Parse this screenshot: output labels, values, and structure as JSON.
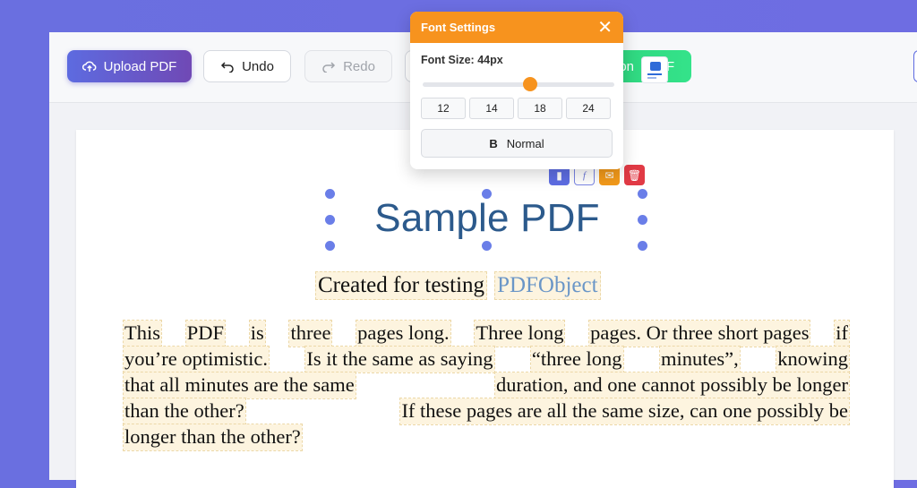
{
  "toolbar": {
    "upload_label": "Upload PDF",
    "undo_label": "Undo",
    "redo_label": "Redo",
    "export_label": "pon",
    "export_trailing": "F"
  },
  "document": {
    "title": "Sample PDF",
    "subtitle_words": [
      "Created for testing",
      "PDFObject"
    ],
    "paragraph_lines": [
      [
        "This",
        "PDF",
        "is",
        "three",
        "pages long.",
        "Three long",
        "pages. Or three short pages",
        "if"
      ],
      [
        "you’re optimistic.",
        "Is it the same as saying",
        "“three long",
        "minutes”,",
        "knowing"
      ],
      [
        "that all minutes are the same",
        "duration, and one cannot possibly be longer"
      ],
      [
        "than the other?",
        "If these pages are all the same size, can one possibly be"
      ],
      [
        "longer than the other?"
      ]
    ]
  },
  "font_settings": {
    "title": "Font Settings",
    "close_glyph": "✕",
    "size_label": "Font Size: 44px",
    "slider_fraction": 0.56,
    "size_presets": [
      "12",
      "14",
      "18",
      "24"
    ],
    "weight_glyph": "B",
    "weight_label": "Normal"
  },
  "element_tools": [
    "▮",
    "f",
    "✉",
    "🗑"
  ],
  "colors": {
    "accent": "#f7931e",
    "brand_gradient_start": "#5d6be0",
    "brand_gradient_end": "#7049b5",
    "title_color": "#2c5a8c",
    "delete_color": "#e13a45"
  }
}
